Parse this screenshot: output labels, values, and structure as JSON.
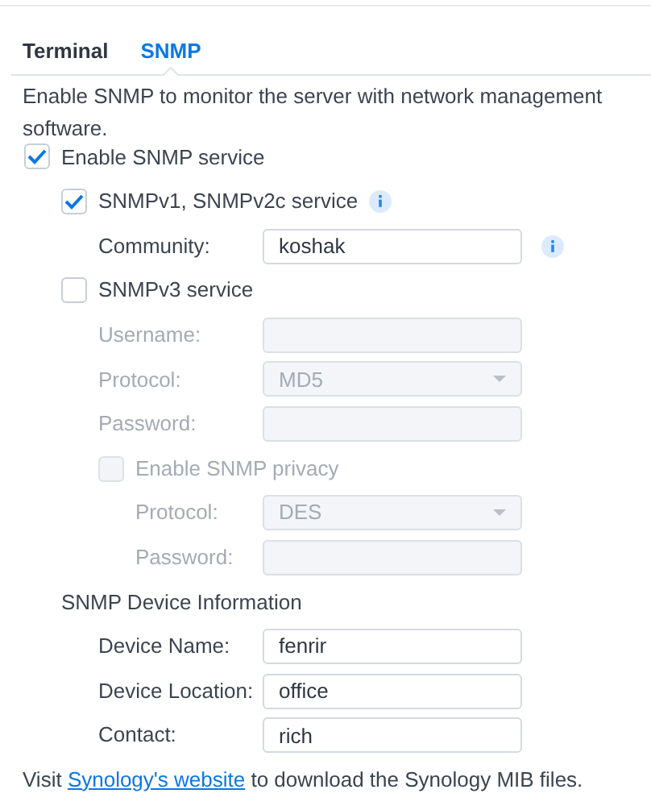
{
  "tabs": [
    {
      "label": "Terminal",
      "selected": false
    },
    {
      "label": "SNMP",
      "selected": true
    }
  ],
  "intro": "Enable SNMP to monitor the server with network management software.",
  "options": [
    {
      "kind": "checkbox",
      "label": "Enable SNMP service",
      "checked": true,
      "disabled": false,
      "children": [
        {
          "kind": "checkbox",
          "label": "SNMPv1, SNMPv2c service",
          "checked": true,
          "disabled": false,
          "info": true,
          "children": [
            {
              "kind": "field",
              "label": "Community:",
              "value": "koshak",
              "disabled": false,
              "info": true
            }
          ]
        },
        {
          "kind": "checkbox",
          "label": "SNMPv3 service",
          "checked": false,
          "disabled": false,
          "children": [
            {
              "kind": "field",
              "label": "Username:",
              "disabled": true
            },
            {
              "kind": "select",
              "label": "Protocol:",
              "value": "MD5",
              "disabled": true
            },
            {
              "kind": "field",
              "label": "Password:",
              "disabled": true
            },
            {
              "kind": "checkbox",
              "label": "Enable SNMP privacy",
              "checked": false,
              "disabled": true,
              "children": [
                {
                  "kind": "select",
                  "label": "Protocol:",
                  "value": "DES",
                  "disabled": true
                },
                {
                  "kind": "field",
                  "label": "Password:",
                  "disabled": true
                }
              ]
            }
          ]
        },
        {
          "kind": "heading",
          "label": "SNMP Device Information",
          "children": [
            {
              "kind": "field",
              "label": "Device Name:",
              "value": "fenrir",
              "disabled": false
            },
            {
              "kind": "field",
              "label": "Device Location:",
              "value": "office",
              "disabled": false
            },
            {
              "kind": "field",
              "label": "Contact:",
              "value": "rich",
              "disabled": false
            }
          ]
        }
      ]
    }
  ],
  "footer": {
    "before": "Visit ",
    "link": "Synology's website",
    "after": " to download the Synology MIB files."
  }
}
